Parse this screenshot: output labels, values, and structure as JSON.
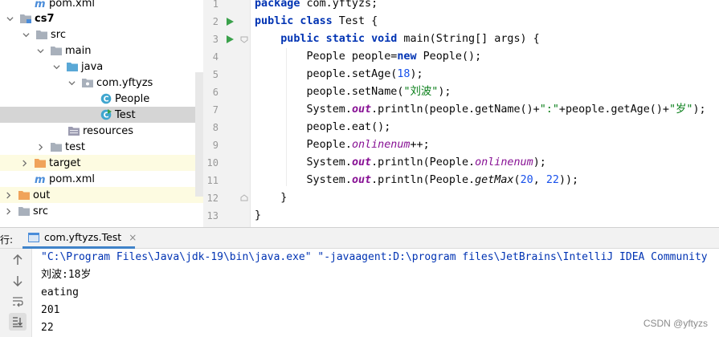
{
  "colors": {
    "keyword": "#0033b3",
    "number": "#1750eb",
    "string": "#067d17",
    "field": "#871094",
    "folder": "#a8b0bb",
    "source_folder": "#5aa8d6",
    "resources_folder": "#9b9bb0",
    "excluded_folder": "#f0a35a",
    "maven": "#4a8cd9",
    "class_icon": "#40a6cf",
    "run_green": "#3aa14b",
    "tab_underline": "#4083c9"
  },
  "tree": {
    "items": [
      {
        "label": "pom.xml",
        "icon": "maven-icon",
        "arrow": "none",
        "bold": false
      },
      {
        "label": "cs7",
        "icon": "module-folder-icon",
        "arrow": "down",
        "bold": true
      },
      {
        "label": "src",
        "icon": "folder-icon",
        "arrow": "down",
        "bold": false
      },
      {
        "label": "main",
        "icon": "folder-icon",
        "arrow": "down",
        "bold": false
      },
      {
        "label": "java",
        "icon": "source-folder-icon",
        "arrow": "down",
        "bold": false
      },
      {
        "label": "com.yftyzs",
        "icon": "package-icon",
        "arrow": "down",
        "bold": false
      },
      {
        "label": "People",
        "icon": "class-icon",
        "arrow": "none",
        "bold": false
      },
      {
        "label": "Test",
        "icon": "runnable-class-icon",
        "arrow": "none",
        "bold": false
      },
      {
        "label": "resources",
        "icon": "resources-folder-icon",
        "arrow": "none",
        "bold": false
      },
      {
        "label": "test",
        "icon": "folder-icon",
        "arrow": "right",
        "bold": false
      },
      {
        "label": "target",
        "icon": "excluded-folder-icon",
        "arrow": "right",
        "bold": false
      },
      {
        "label": "pom.xml",
        "icon": "maven-icon",
        "arrow": "none",
        "bold": false
      },
      {
        "label": "out",
        "icon": "excluded-folder-icon",
        "arrow": "right",
        "bold": false
      },
      {
        "label": "src",
        "icon": "folder-icon",
        "arrow": "right",
        "bold": false
      }
    ]
  },
  "editor": {
    "line_numbers": [
      "1",
      "2",
      "3",
      "4",
      "5",
      "6",
      "7",
      "8",
      "9",
      "10",
      "11",
      "12",
      "13"
    ],
    "run_markers": [
      "2",
      "3"
    ]
  },
  "run": {
    "label": "行:",
    "tab_title": "com.yftyzs.Test",
    "tab_close": "×",
    "output": [
      "\"C:\\Program Files\\Java\\jdk-19\\bin\\java.exe\" \"-javaagent:D:\\program files\\JetBrains\\IntelliJ IDEA Community",
      "刘波:18岁",
      "eating",
      "201",
      "22"
    ]
  },
  "watermark": "CSDN @yftyzs"
}
